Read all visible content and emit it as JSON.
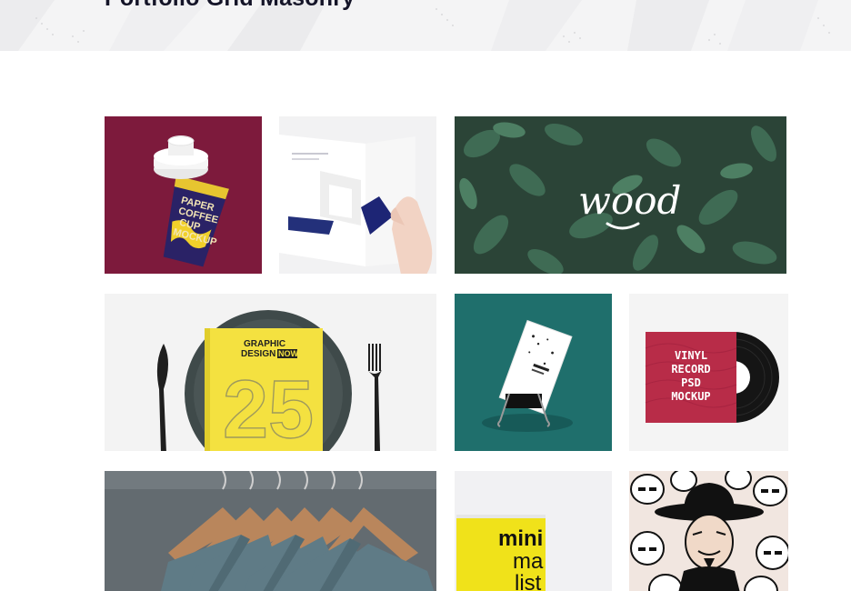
{
  "header": {
    "title": "Portfolio Grid Masonry"
  },
  "gallery": {
    "items": [
      {
        "icon": "paper-coffee-cup-mockup",
        "text_lines": [
          "PAPER",
          "COFFEE",
          "CUP",
          "MOCKUP"
        ]
      },
      {
        "icon": "open-magazine-mockup"
      },
      {
        "icon": "green-leaves-wood-logo",
        "text": "wood"
      },
      {
        "icon": "graphic-design-book-on-plate",
        "text_lines": [
          "GRAPHIC",
          "DESIGN",
          "NOW"
        ],
        "number": "25"
      },
      {
        "icon": "business-card-binder-clip"
      },
      {
        "icon": "vinyl-record-mockup",
        "text_lines": [
          "VINYL",
          "RECORD",
          "PSD",
          "MOCKUP"
        ]
      },
      {
        "icon": "tshirts-on-hangers"
      },
      {
        "icon": "mini-magazine-cover",
        "text_lines": [
          "mini",
          "ma",
          "list"
        ]
      },
      {
        "icon": "illustration-pattern-character"
      }
    ]
  },
  "colors": {
    "title": "#141428",
    "header_bg": "#f4f4f5",
    "cup_bg": "#7d1a3c",
    "leaves_bg": "#2b4437",
    "teal_bg": "#1f6f6c",
    "vinyl_sleeve": "#b82c48",
    "book_yellow": "#f4e140",
    "mini_yellow": "#f0e21a"
  }
}
